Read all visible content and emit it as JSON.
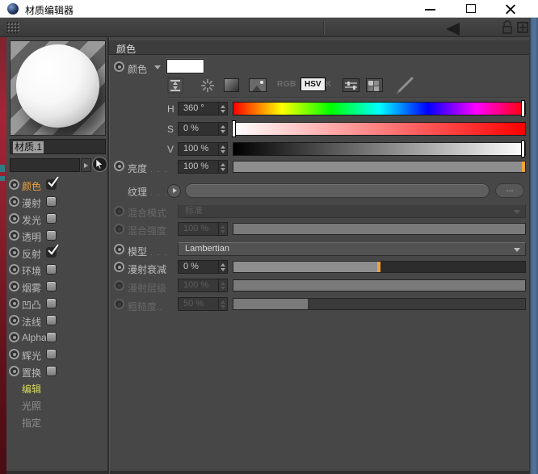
{
  "window": {
    "title": "材质编辑器"
  },
  "left_panel": {
    "material_name": "材质.1",
    "channels": [
      {
        "label": "颜色",
        "checked": true,
        "active": true
      },
      {
        "label": "漫射",
        "checked": false,
        "active": false
      },
      {
        "label": "发光",
        "checked": false,
        "active": false
      },
      {
        "label": "透明",
        "checked": false,
        "active": false
      },
      {
        "label": "反射",
        "checked": true,
        "active": false
      },
      {
        "label": "环境",
        "checked": false,
        "active": false
      },
      {
        "label": "烟雾",
        "checked": false,
        "active": false
      },
      {
        "label": "凹凸",
        "checked": false,
        "active": false
      },
      {
        "label": "法线",
        "checked": false,
        "active": false
      },
      {
        "label": "Alpha",
        "checked": false,
        "active": false
      },
      {
        "label": "辉光",
        "checked": false,
        "active": false
      },
      {
        "label": "置换",
        "checked": false,
        "active": false
      }
    ],
    "pages": [
      {
        "label": "编辑",
        "active": true
      },
      {
        "label": "光照",
        "active": false
      },
      {
        "label": "指定",
        "active": false
      }
    ]
  },
  "color_section": {
    "header": "颜色",
    "channel_label": "颜色",
    "mode_rgb": "RGB",
    "mode_hsv": "HSV",
    "mode_k": "K",
    "h_label": "H",
    "h_value": "360 °",
    "s_label": "S",
    "s_value": "0 %",
    "v_label": "V",
    "v_value": "100 %",
    "brightness_label": "亮度",
    "brightness_dots": ". . .",
    "brightness_value": "100 %",
    "texture_label": "纹理",
    "texture_dots": ". . .",
    "texture_more": "...",
    "mix_mode_label": "混合模式",
    "mix_mode_value": "标准",
    "mix_strength_label": "混合强度",
    "mix_strength_value": "100 %"
  },
  "model_section": {
    "model_label": "模型",
    "model_dots": ". . .",
    "model_value": "Lambertian",
    "falloff_label": "漫射衰减",
    "falloff_value": "0 %",
    "level_label": "漫射层级",
    "level_value": "100 %",
    "roughness_label": "粗糙度..",
    "roughness_value": "50 %"
  },
  "colors": {
    "accent_orange": "#eea33b",
    "channel_active": "#e8a23c",
    "page_active": "#d8da5e",
    "window_border": "#4d6e96",
    "titlebar": "#ffffff",
    "panel_bg": "#474747"
  }
}
